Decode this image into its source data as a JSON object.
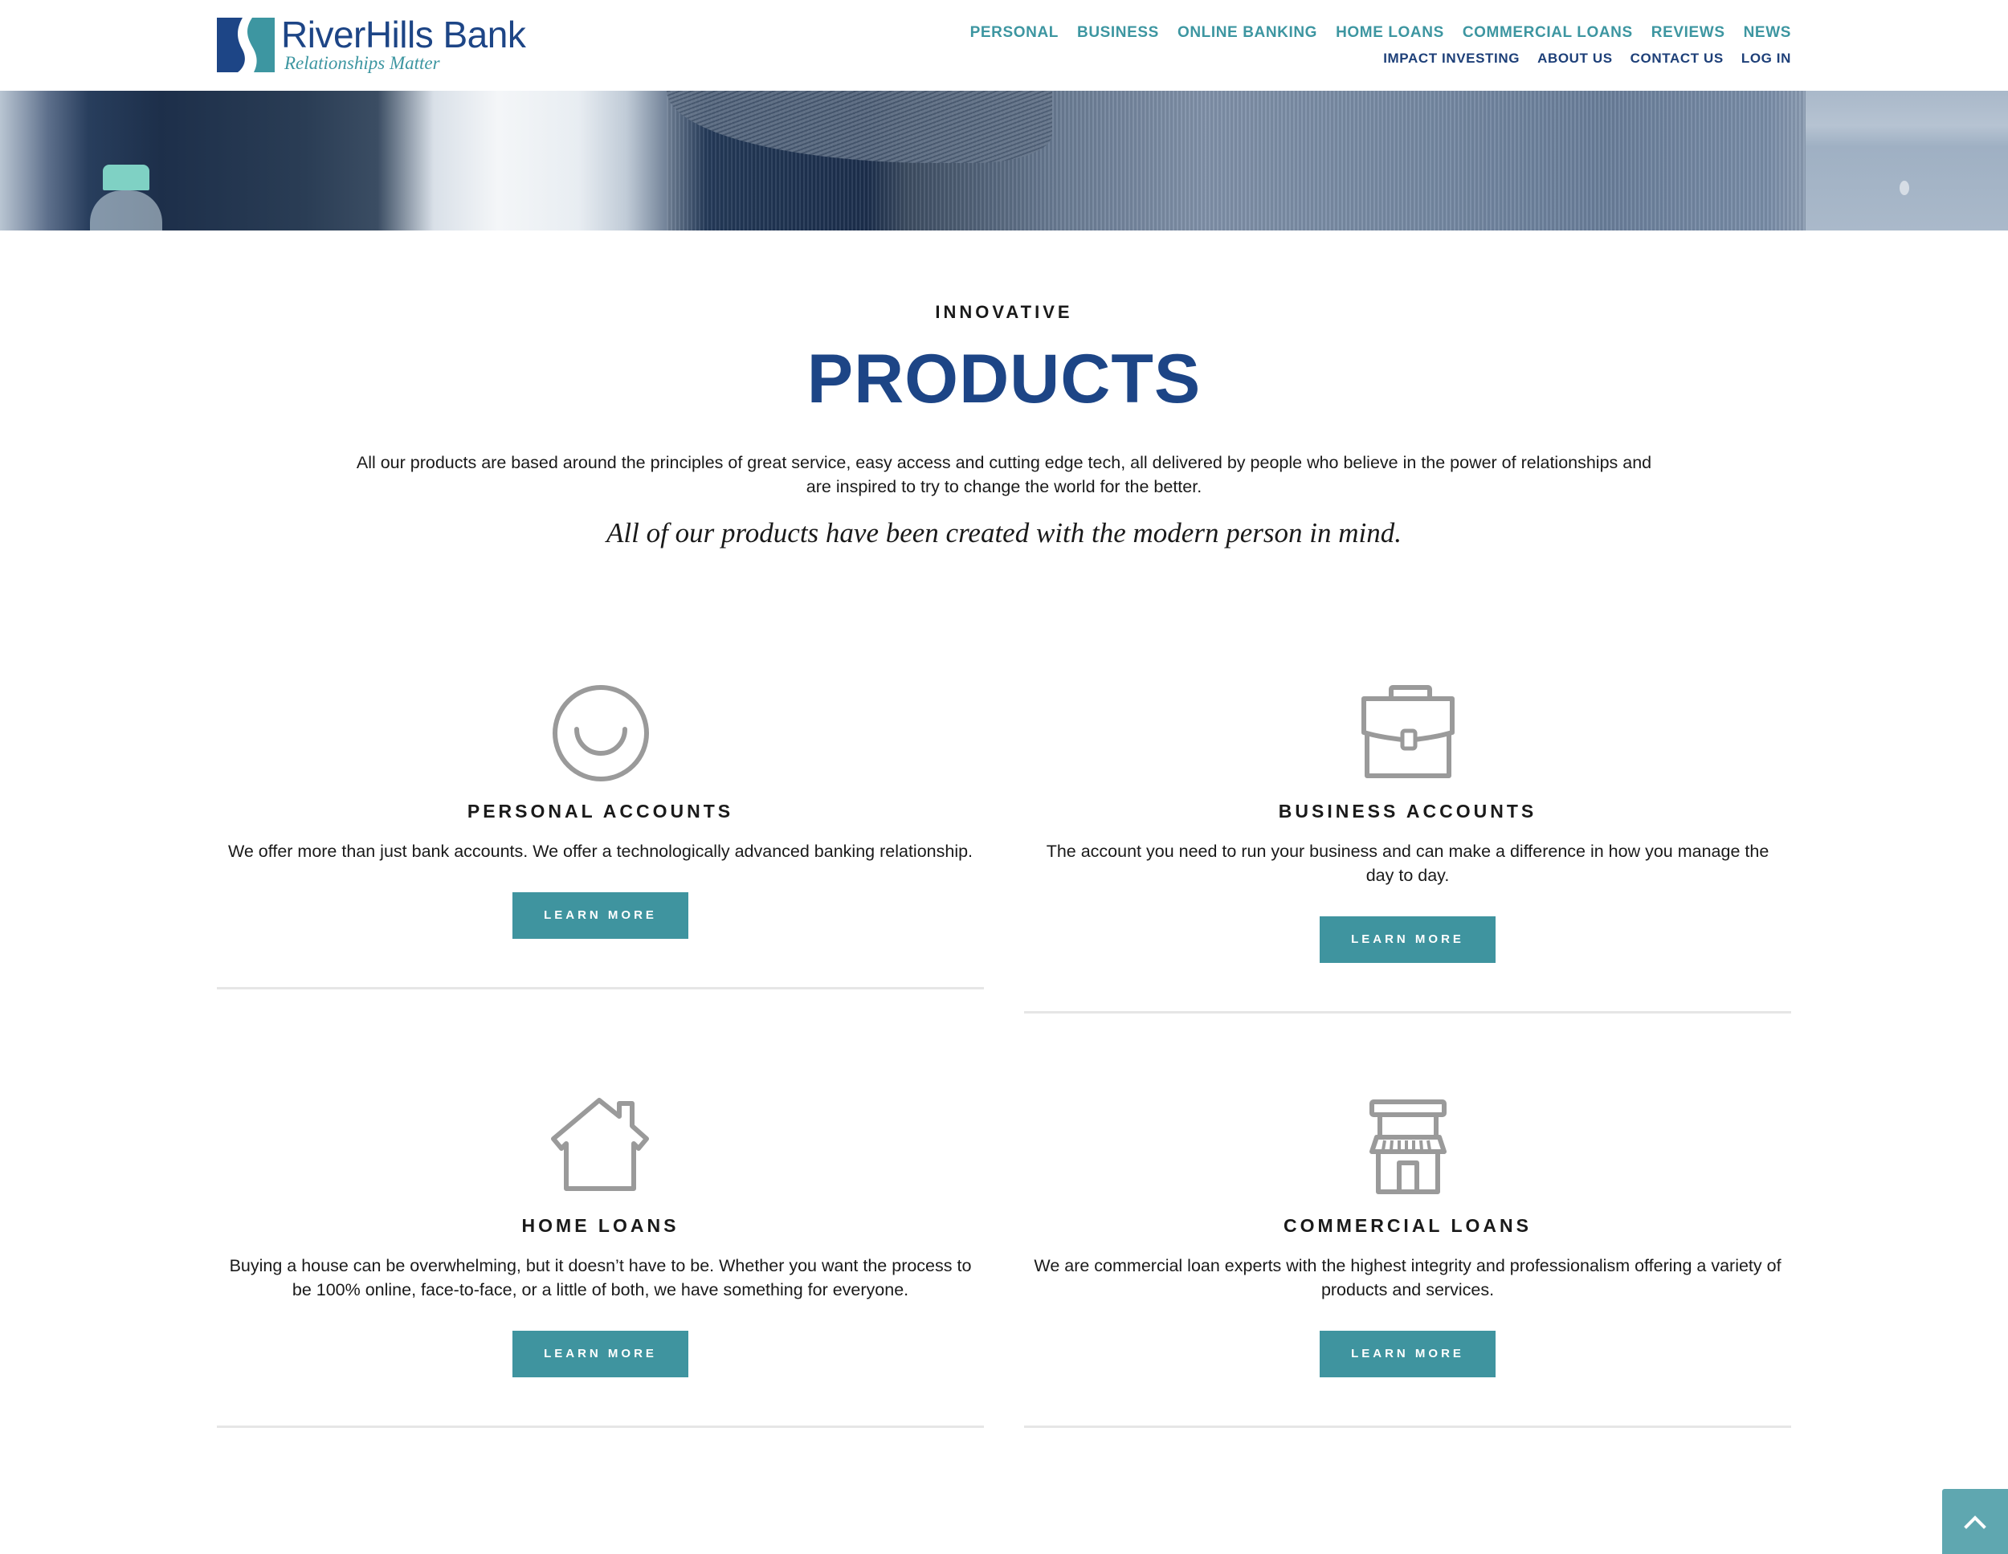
{
  "brand": {
    "name": "RiverHills Bank",
    "tagline": "Relationships Matter",
    "colors": {
      "navy": "#1d4586",
      "teal": "#3d96a1",
      "button": "#3f949f",
      "icon_gray": "#9a9a9a"
    }
  },
  "nav": {
    "primary": [
      {
        "label": "PERSONAL"
      },
      {
        "label": "BUSINESS"
      },
      {
        "label": "ONLINE BANKING"
      },
      {
        "label": "HOME LOANS"
      },
      {
        "label": "COMMERCIAL LOANS"
      },
      {
        "label": "REVIEWS"
      },
      {
        "label": "NEWS"
      }
    ],
    "secondary": [
      {
        "label": "IMPACT INVESTING"
      },
      {
        "label": "ABOUT US"
      },
      {
        "label": "CONTACT US"
      },
      {
        "label": "LOG IN"
      }
    ]
  },
  "intro": {
    "eyebrow": "INNOVATIVE",
    "title": "PRODUCTS",
    "body": "All our products are based around the principles of great service, easy access and cutting edge tech, all delivered by people who believe in the power of relationships and are inspired to try to change the world for the better.",
    "tagline": "All of our products have been created with the modern person in mind."
  },
  "products": [
    {
      "icon": "smiley-icon",
      "title": "PERSONAL ACCOUNTS",
      "description": "We offer more than just bank accounts. We offer a technologically advanced banking relationship.",
      "button": "LEARN MORE"
    },
    {
      "icon": "briefcase-icon",
      "title": "BUSINESS ACCOUNTS",
      "description": "The account you need to run your business and can make a difference in how you manage the day to day.",
      "button": "LEARN MORE"
    },
    {
      "icon": "house-icon",
      "title": "HOME LOANS",
      "description": "Buying a house can be overwhelming, but it doesn’t have to be. Whether you want the process to be 100% online, face-to-face, or a little of both, we have something for everyone.",
      "button": "LEARN MORE"
    },
    {
      "icon": "storefront-icon",
      "title": "COMMERCIAL LOANS",
      "description": "We are commercial loan experts with the highest integrity and professionalism offering a variety of products and services.",
      "button": "LEARN MORE"
    }
  ],
  "scroll_top": {
    "icon": "chevron-up-icon"
  }
}
